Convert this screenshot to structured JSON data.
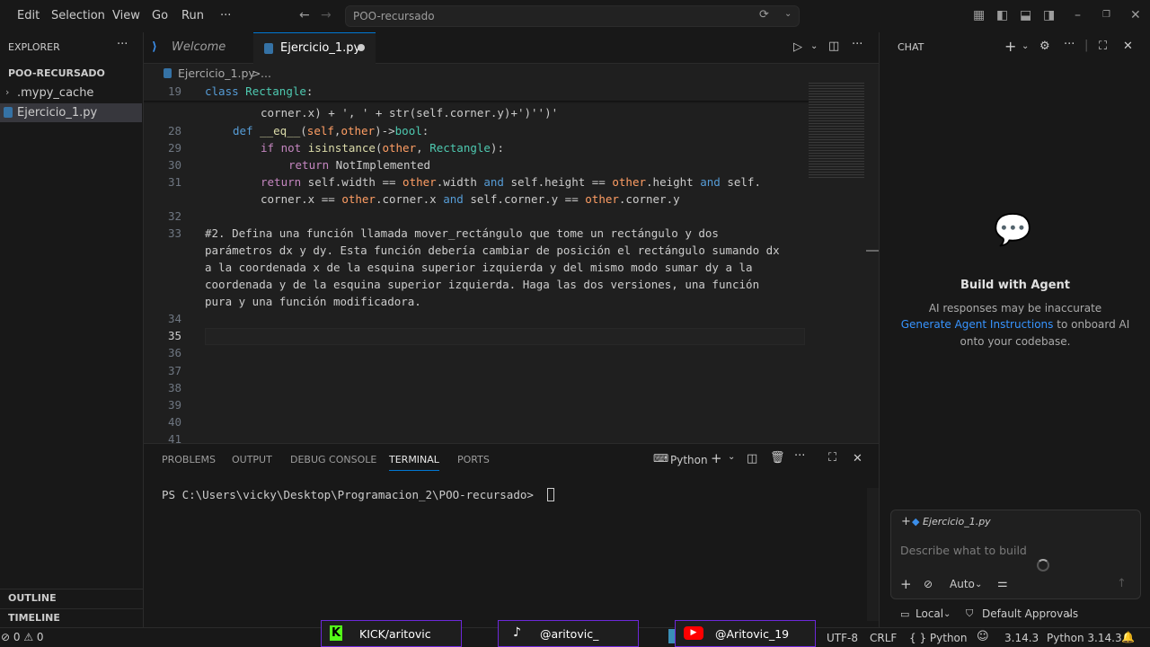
{
  "menu": [
    "Edit",
    "Selection",
    "View",
    "Go",
    "Run",
    "···"
  ],
  "command_center": "POO-recursado",
  "explorer": {
    "title": "EXPLORER",
    "folder": "POO-RECURSADO",
    "items": [
      ".mypy_cache",
      "Ejercicio_1.py"
    ],
    "outline": "OUTLINE",
    "timeline": "TIMELINE"
  },
  "tabs": {
    "welcome": "Welcome",
    "active": "Ejercicio_1.py"
  },
  "breadcrumb": {
    "file": "Ejercicio_1.py",
    "sep": ">",
    "more": "..."
  },
  "line_numbers": [
    "19",
    "28",
    "29",
    "30",
    "31",
    "32",
    "33",
    "34",
    "35",
    "36",
    "37",
    "38",
    "39",
    "40",
    "41"
  ],
  "code": {
    "l19_a": "class",
    "l19_b": "Rectangle",
    "l19_c": ":",
    "lwrap": "corner.x) + ', ' + str(self.corner.y)+')'')'",
    "l28": "def __eq__(self,other)->bool:",
    "l29": "if not isinstance(other, Rectangle):",
    "l30": "return NotImplemented",
    "l31a": "return self.width == other.width and self.height == other.height and self.",
    "l31b": "corner.x == other.corner.x and self.corner.y == other.corner.y",
    "comment": [
      "#2. Defina una función llamada mover_rectángulo que tome un rectángulo y dos",
      "parámetros dx y dy. Esta función debería cambiar de posición el rectángulo sumando dx",
      "a la coordenada x de la esquina superior izquierda y del mismo modo sumar dy a la",
      "coordenada y de la esquina superior izquierda. Haga las dos versiones, una función",
      "pura y una función modificadora."
    ]
  },
  "panel": {
    "tabs": [
      "PROBLEMS",
      "OUTPUT",
      "DEBUG CONSOLE",
      "TERMINAL",
      "PORTS"
    ],
    "terminal_kind": "Python",
    "prompt": "PS C:\\Users\\vicky\\Desktop\\Programacion_2\\POO-recursado>"
  },
  "chat": {
    "title": "CHAT",
    "heading": "Build with Agent",
    "line1": "AI responses may be inaccurate",
    "link": "Generate Agent Instructions",
    "line2": "to onboard AI",
    "line3": "onto your codebase.",
    "context_file": "Ejercicio_1.py",
    "placeholder": "Describe what to build",
    "mode": "Auto",
    "location": "Local",
    "approvals": "Default Approvals"
  },
  "status": {
    "errors": "0",
    "warnings": "0",
    "encoding": "UTF-8",
    "eol": "CRLF",
    "language": "Python",
    "version": "3.14.3",
    "interpreter": "Python 3.14.3"
  },
  "overlays": {
    "kick": "KICK/aritovic",
    "tiktok": "@aritovic_",
    "youtube": "@Aritovic_19"
  }
}
